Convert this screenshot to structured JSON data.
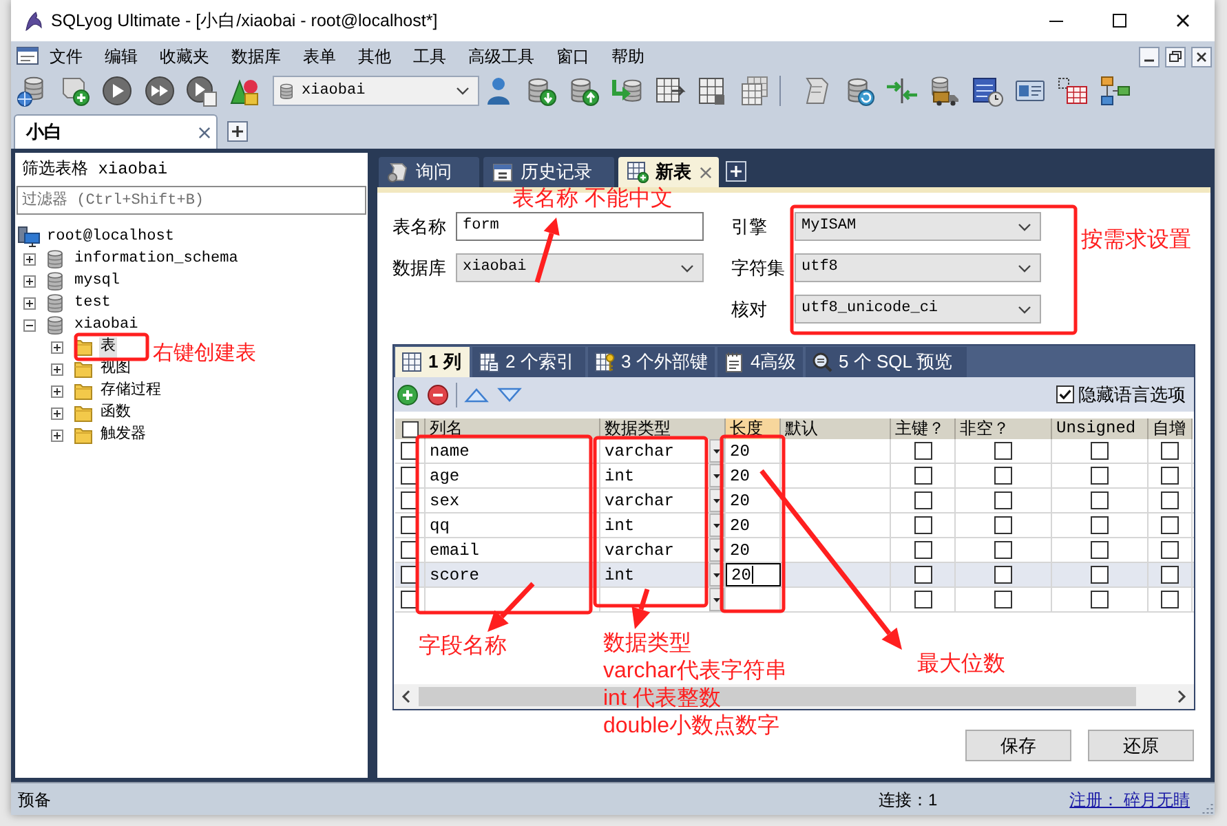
{
  "window": {
    "title": "SQLyog Ultimate - [小白/xiaobai - root@localhost*]"
  },
  "menu": [
    "文件",
    "编辑",
    "收藏夹",
    "数据库",
    "表单",
    "其他",
    "工具",
    "高级工具",
    "窗口",
    "帮助"
  ],
  "toolbar": {
    "database": "xiaobai"
  },
  "connection_tabs": [
    {
      "label": "小白",
      "selected": true,
      "closable": true
    }
  ],
  "object_browser": {
    "title": "筛选表格 xiaobai",
    "filter": {
      "placeholder": "过滤器 (Ctrl+Shift+B)"
    },
    "tree": [
      {
        "label": "root@localhost",
        "kind": "server",
        "selected": false,
        "children": [
          {
            "label": "information_schema",
            "kind": "database",
            "expanded": false,
            "selected": false
          },
          {
            "label": "mysql",
            "kind": "database",
            "expanded": false,
            "selected": false
          },
          {
            "label": "test",
            "kind": "database",
            "expanded": false,
            "selected": false
          },
          {
            "label": "xiaobai",
            "kind": "database",
            "expanded": true,
            "selected": false,
            "children": [
              {
                "label": "表",
                "kind": "folder",
                "expanded": false,
                "selected": true
              },
              {
                "label": "视图",
                "kind": "folder",
                "expanded": false,
                "selected": false
              },
              {
                "label": "存储过程",
                "kind": "folder",
                "expanded": false,
                "selected": false
              },
              {
                "label": "函数",
                "kind": "folder",
                "expanded": false,
                "selected": false
              },
              {
                "label": "触发器",
                "kind": "folder",
                "expanded": false,
                "selected": false
              }
            ]
          }
        ]
      }
    ]
  },
  "editor_tabs": [
    {
      "label": "询问",
      "selected": false,
      "closable": false
    },
    {
      "label": "历史记录",
      "selected": false,
      "closable": false
    },
    {
      "label": "新表",
      "selected": true,
      "closable": true
    }
  ],
  "table_form": {
    "name": {
      "label": "表名称",
      "value": "form"
    },
    "database": {
      "label": "数据库",
      "value": "xiaobai"
    },
    "engine": {
      "label": "引擎",
      "value": "MyISAM"
    },
    "charset": {
      "label": "字符集",
      "value": "utf8"
    },
    "collation": {
      "label": "核对",
      "value": "utf8_unicode_ci"
    }
  },
  "column_editor": {
    "tabs": [
      {
        "label": "1 列",
        "selected": true
      },
      {
        "label": "2 个索引",
        "selected": false
      },
      {
        "label": "3 个外部键",
        "selected": false
      },
      {
        "label": "4高级",
        "selected": false
      },
      {
        "label": "5 个 SQL 预览",
        "selected": false
      }
    ],
    "hide_language_options": {
      "label": "隐藏语言选项",
      "checked": true
    },
    "select_all": {
      "checked": false
    },
    "columns": [
      {
        "label": "列名",
        "selected": false
      },
      {
        "label": "数据类型",
        "selected": false
      },
      {
        "label": "长度",
        "selected": true
      },
      {
        "label": "默认",
        "selected": false
      },
      {
        "label": "主键？",
        "selected": false
      },
      {
        "label": "非空？",
        "selected": false
      },
      {
        "label": "Unsigned",
        "selected": false
      },
      {
        "label": "自增",
        "selected": false
      }
    ],
    "rows": [
      {
        "name": "name",
        "type": "varchar",
        "length": "20",
        "checked": false,
        "primary_key": false,
        "not_null": false,
        "unsigned": false,
        "auto_increment": false,
        "selected": false
      },
      {
        "name": "age",
        "type": "int",
        "length": "20",
        "checked": false,
        "primary_key": false,
        "not_null": false,
        "unsigned": false,
        "auto_increment": false,
        "selected": false
      },
      {
        "name": "sex",
        "type": "varchar",
        "length": "20",
        "checked": false,
        "primary_key": false,
        "not_null": false,
        "unsigned": false,
        "auto_increment": false,
        "selected": false
      },
      {
        "name": "qq",
        "type": "int",
        "length": "20",
        "checked": false,
        "primary_key": false,
        "not_null": false,
        "unsigned": false,
        "auto_increment": false,
        "selected": false
      },
      {
        "name": "email",
        "type": "varchar",
        "length": "20",
        "checked": false,
        "primary_key": false,
        "not_null": false,
        "unsigned": false,
        "auto_increment": false,
        "selected": false
      },
      {
        "name": "score",
        "type": "int",
        "length": "20",
        "checked": false,
        "primary_key": false,
        "not_null": false,
        "unsigned": false,
        "auto_increment": false,
        "selected": true
      }
    ],
    "new_row": {
      "checked": false,
      "primary_key": false,
      "not_null": false,
      "unsigned": false,
      "auto_increment": false
    }
  },
  "buttons": [
    "保存",
    "还原"
  ],
  "status_bar": {
    "status": "预备",
    "connection": "连接：1",
    "registration": "注册： 碎月无睛"
  },
  "annotations": {
    "table_name": "表名称 不能中文",
    "options": "按需求设置",
    "tree": "右键创建表",
    "field_name": "字段名称",
    "data_type": [
      "数据类型",
      "varchar代表字符串",
      "int 代表整数",
      "double小数点数字"
    ],
    "length": "最大位数"
  }
}
